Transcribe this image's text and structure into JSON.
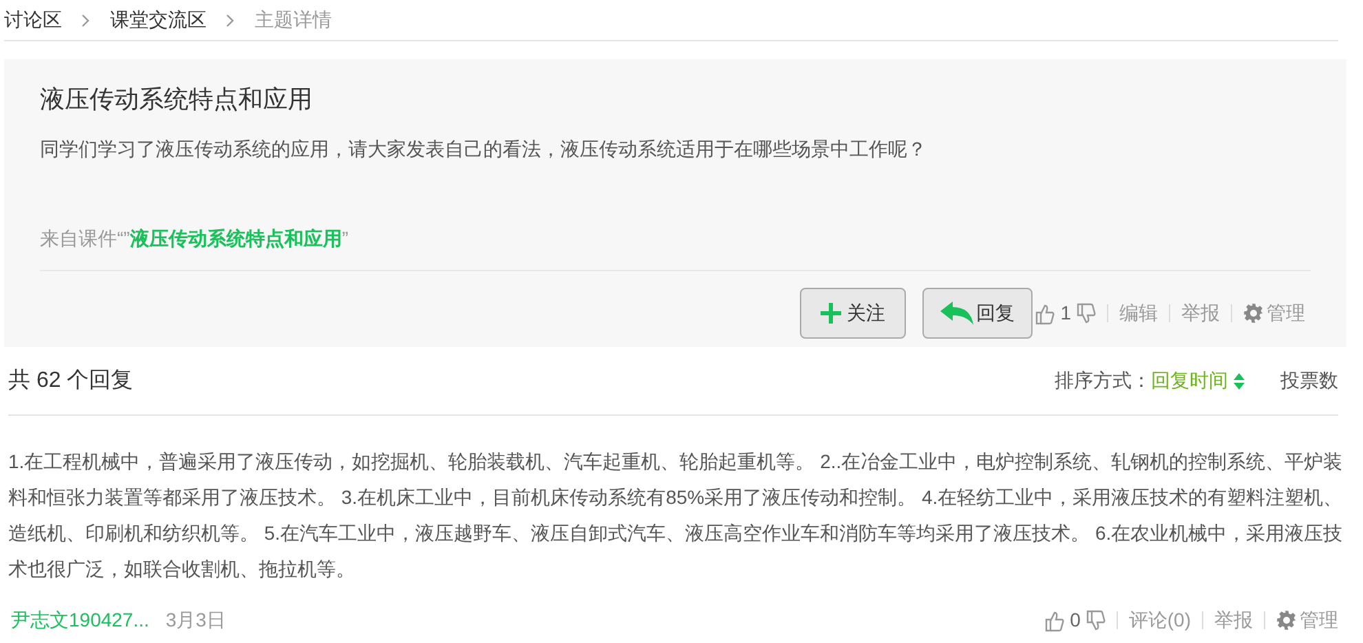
{
  "breadcrumb": [
    {
      "label": "讨论区",
      "current": false
    },
    {
      "label": "课堂交流区",
      "current": false
    },
    {
      "label": "主题详情",
      "current": true
    }
  ],
  "topic": {
    "title": "液压传动系统特点和应用",
    "body": "同学们学习了液压传动系统的应用，请大家发表自己的看法，液压传动系统适用于在哪些场景中工作呢？",
    "source_prefix": "来自课件“”",
    "source_link": "液压传动系统特点和应用",
    "source_suffix": "”",
    "follow_button": "关注",
    "reply_button": "回复",
    "likes": "1",
    "actions": [
      "编辑",
      "举报"
    ],
    "manage": "管理"
  },
  "replies_header": {
    "count_text": "共 62 个回复",
    "sort_label": "排序方式：",
    "sort_options": [
      {
        "label": "回复时间",
        "selected": true
      },
      {
        "label": "投票数",
        "selected": false
      }
    ]
  },
  "reply": {
    "text": "1.在工程机械中，普遍采用了液压传动，如挖掘机、轮胎装载机、汽车起重机、轮胎起重机等。 2..在冶金工业中，电炉控制系统、轧钢机的控制系统、平炉装料和恒张力装置等都采用了液压技术。 3.在机床工业中，目前机床传动系统有85%采用了液压传动和控制。 4.在轻纺工业中，采用液压技术的有塑料注塑机、造纸机、印刷机和纺织机等。 5.在汽车工业中，液压越野车、液压自卸式汽车、液压高空作业车和消防车等均采用了液压技术。 6.在农业机械中，采用液压技术也很广泛，如联合收割机、拖拉机等。",
    "author": "尹志文190427...",
    "date": "3月3日",
    "likes": "0",
    "actions": [
      "评论(0)",
      "举报"
    ],
    "manage": "管理"
  }
}
